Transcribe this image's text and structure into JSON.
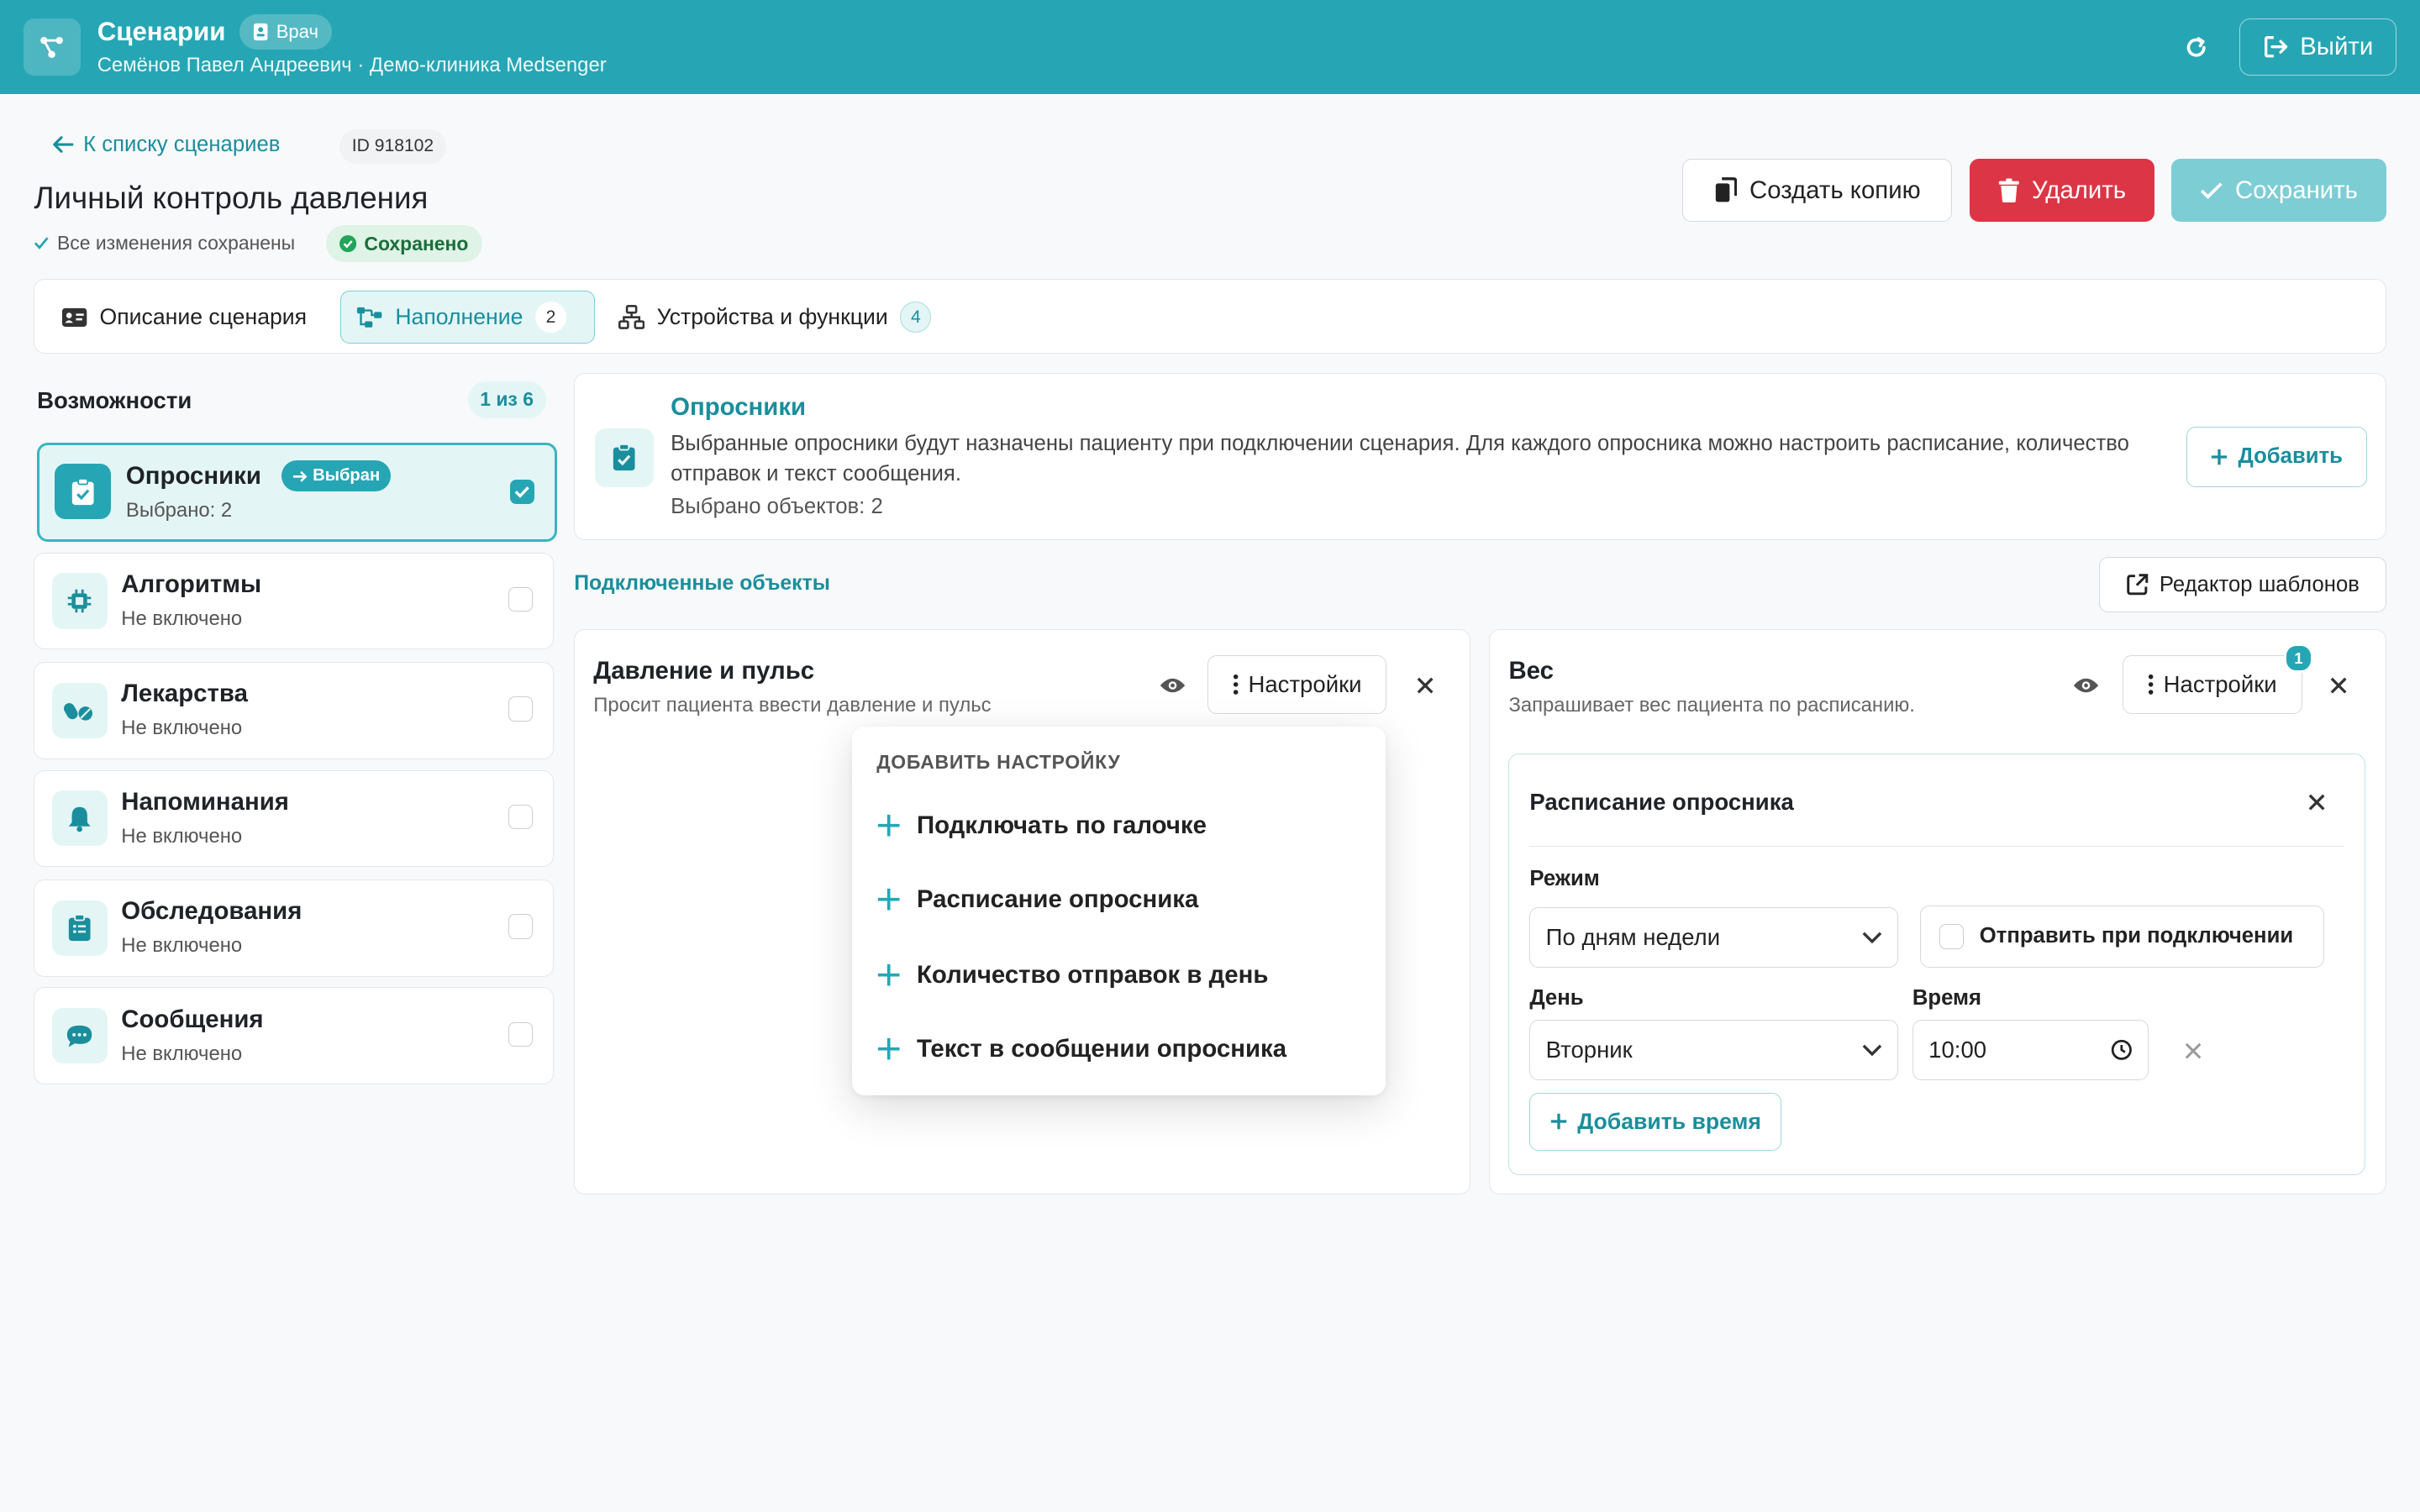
{
  "header": {
    "app_title": "Сценарии",
    "role_badge": "Врач",
    "user_line": "Семёнов Павел Андреевич · Демо-клиника Medsenger",
    "logout_label": "Выйти"
  },
  "page": {
    "back_link": "К списку сценариев",
    "id_chip": "ID 918102",
    "title": "Личный контроль давления",
    "autosave_text": "Все изменения сохранены",
    "saved_badge": "Сохранено",
    "actions": {
      "copy_label": "Создать копию",
      "delete_label": "Удалить",
      "save_label": "Сохранить"
    }
  },
  "tabs": [
    {
      "label": "Описание сценария",
      "count": ""
    },
    {
      "label": "Наполнение",
      "count": "2"
    },
    {
      "label": "Устройства и функции",
      "count": "4"
    }
  ],
  "capabilities": {
    "title": "Возможности",
    "count_label": "1 из 6",
    "selected_pill": "Выбран",
    "items": [
      {
        "name": "Опросники",
        "status": "Выбрано: 2",
        "icon": "clipboard-check-icon",
        "selected": true
      },
      {
        "name": "Алгоритмы",
        "status": "Не включено",
        "icon": "chip-icon",
        "selected": false
      },
      {
        "name": "Лекарства",
        "status": "Не включено",
        "icon": "pills-icon",
        "selected": false
      },
      {
        "name": "Напоминания",
        "status": "Не включено",
        "icon": "bell-icon",
        "selected": false
      },
      {
        "name": "Обследования",
        "status": "Не включено",
        "icon": "clipboard-list-icon",
        "selected": false
      },
      {
        "name": "Сообщения",
        "status": "Не включено",
        "icon": "chat-icon",
        "selected": false
      }
    ]
  },
  "info_card": {
    "title": "Опросники",
    "description": "Выбранные опросники будут назначены пациенту при подключении сценария. Для каждого опросника можно настроить расписание, количество отправок и текст сообщения.",
    "selected_count": "Выбрано объектов: 2",
    "add_label": "Добавить"
  },
  "connected": {
    "label": "Подключенные объекты",
    "templates_label": "Редактор шаблонов",
    "objects": [
      {
        "title": "Давление и пульс",
        "description": "Просит пациента ввести давление и пульс",
        "settings_label": "Настройки"
      },
      {
        "title": "Вес",
        "description": "Запрашивает вес пациента по расписанию.",
        "settings_label": "Настройки",
        "settings_badge": "1"
      }
    ]
  },
  "dropdown": {
    "header": "ДОБАВИТЬ НАСТРОЙКУ",
    "items": [
      "Подключать по галочке",
      "Расписание опросника",
      "Количество отправок в день",
      "Текст в сообщении опросника"
    ]
  },
  "schedule": {
    "title": "Расписание опросника",
    "mode_label": "Режим",
    "mode_value": "По дням недели",
    "send_on_connect_label": "Отправить при подключении",
    "day_label": "День",
    "day_value": "Вторник",
    "time_label": "Время",
    "time_value": "10:00",
    "add_time_label": "Добавить время"
  },
  "colors": {
    "brand": "#26a6b4",
    "brand_dark": "#1a8e9c",
    "danger": "#dc3545",
    "success_bg": "#dff3e6"
  }
}
